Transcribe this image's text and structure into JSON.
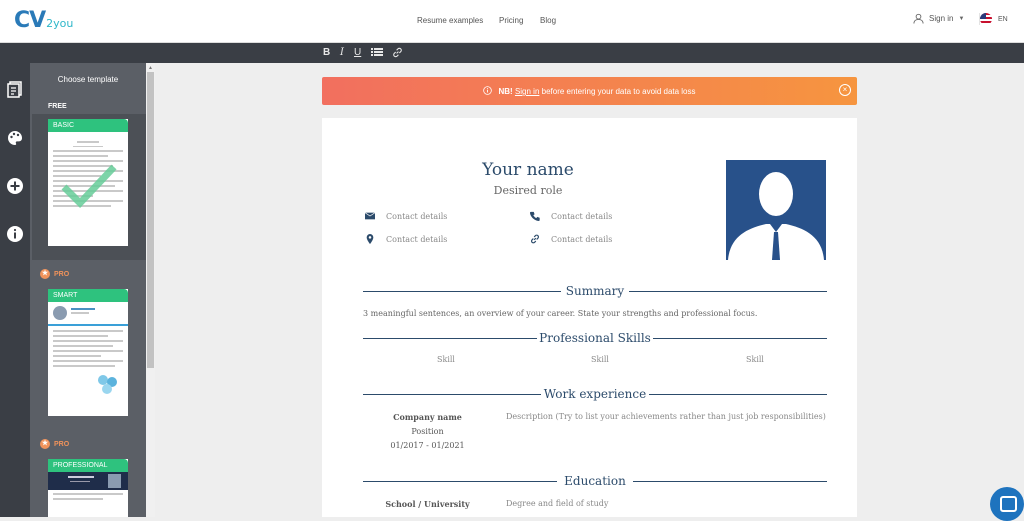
{
  "header": {
    "logo_main": "CV",
    "logo_sub": "2you",
    "nav": [
      "Resume examples",
      "Pricing",
      "Blog"
    ],
    "sign_in": "Sign in",
    "lang": "EN"
  },
  "toolbar": {
    "bold": "B",
    "italic": "I",
    "underline": "U"
  },
  "sidebar": {
    "title": "Choose template",
    "free_label": "FREE",
    "pro_label": "PRO",
    "templates": [
      {
        "name": "BASIC",
        "tier": "FREE"
      },
      {
        "name": "SMART",
        "tier": "PRO"
      },
      {
        "name": "PROFESSIONAL",
        "tier": "PRO"
      }
    ]
  },
  "banner": {
    "nb": "NB!",
    "link": "Sign in",
    "text": " before entering your data to avoid data loss"
  },
  "resume": {
    "name": "Your name",
    "role": "Desired role",
    "contacts": [
      "Contact details",
      "Contact details",
      "Contact details",
      "Contact details"
    ],
    "summary_title": "Summary",
    "summary_text": "3 meaningful sentences, an overview of your career. State your strengths and professional focus.",
    "skills_title": "Professional Skills",
    "skills": [
      "Skill",
      "Skill",
      "Skill"
    ],
    "work_title": "Work experience",
    "work": {
      "company": "Company name",
      "position": "Position",
      "dates": "01/2017 - 01/2021",
      "description": "Description (Try to list your achievements rather than just job responsibilities)"
    },
    "education_title": "Education",
    "education": {
      "school": "School / University",
      "degree": "Degree and field of study"
    }
  },
  "colors": {
    "accent_navy": "#2c4b6b",
    "banner_start": "#f26f5f",
    "banner_end": "#f6953f",
    "template_tag": "#2ec27e",
    "pro": "#f0935b"
  }
}
